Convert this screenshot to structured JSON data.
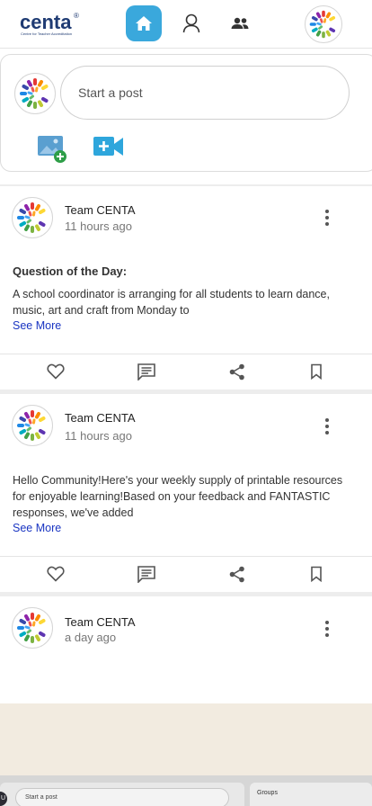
{
  "header": {
    "logo_text": "centa",
    "logo_reg": "®",
    "logo_tagline": "Centre for Teacher Accreditation",
    "nav": [
      "home-icon",
      "profile-icon",
      "groups-icon"
    ],
    "accent": "#3aa8dc"
  },
  "composer": {
    "placeholder": "Start a post",
    "photo_icon": "add-photo-icon",
    "video_icon": "add-video-icon"
  },
  "posts": [
    {
      "author": "Team CENTA",
      "time": "11 hours ago",
      "heading": "Question of the Day:",
      "body": "A school coordinator is arranging for all students to learn dance, music, art and craft from Monday to",
      "see_more": "See More"
    },
    {
      "author": "Team CENTA",
      "time": "11 hours ago",
      "heading": "",
      "body": "Hello Community!Here's your weekly supply of printable resources for enjoyable learning!Based on your feedback and FANTASTIC responses, we've added",
      "see_more": "See More"
    },
    {
      "author": "Team CENTA",
      "time": "a day ago"
    }
  ],
  "actions": [
    "like-icon",
    "comment-icon",
    "share-icon",
    "bookmark-icon"
  ],
  "background_preview": {
    "start_post": "Start a post",
    "groups": "Groups",
    "badge": "U"
  }
}
